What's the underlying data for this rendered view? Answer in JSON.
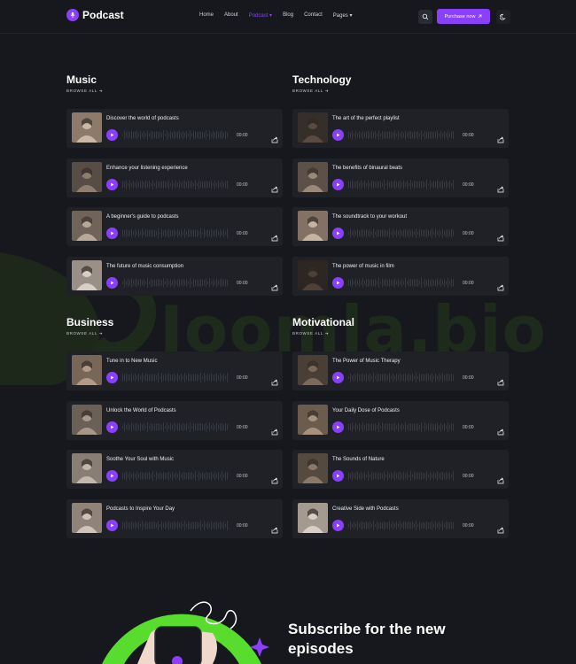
{
  "header": {
    "logo_text": "Podcast",
    "nav": [
      {
        "label": "Home",
        "active": false
      },
      {
        "label": "About",
        "active": false
      },
      {
        "label": "Podcast ▾",
        "active": true
      },
      {
        "label": "Blog",
        "active": false
      },
      {
        "label": "Contact",
        "active": false
      },
      {
        "label": "Pages ▾",
        "active": false
      }
    ],
    "purchase_label": "Purchase now",
    "accent": "#8a3ffc"
  },
  "watermark": "Joomla.bio",
  "sections": [
    {
      "title": "Music",
      "browse": "BROWSE ALL ➔",
      "items": [
        {
          "title": "Discover the world of podcasts",
          "time": "00:00"
        },
        {
          "title": "Enhance your listening experience",
          "time": "00:00"
        },
        {
          "title": "A beginner's guide to podcasts",
          "time": "00:00"
        },
        {
          "title": "The future of music consumption",
          "time": "00:00"
        }
      ]
    },
    {
      "title": "Technology",
      "browse": "BROWSE ALL ➔",
      "items": [
        {
          "title": "The art of the perfect playlist",
          "time": "00:00"
        },
        {
          "title": "The benefits of binaural beats",
          "time": "00:00"
        },
        {
          "title": "The soundtrack to your workout",
          "time": "00:00"
        },
        {
          "title": "The power of music in film",
          "time": "00:00"
        }
      ]
    },
    {
      "title": "Business",
      "browse": "BROWSE ALL ➔",
      "items": [
        {
          "title": "Tune in to New Music",
          "time": "00:00"
        },
        {
          "title": "Unlock the World of Podcasts",
          "time": "00:00"
        },
        {
          "title": "Soothe Your Soul with Music",
          "time": "00:00"
        },
        {
          "title": "Podcasts to Inspire Your Day",
          "time": "00:00"
        }
      ]
    },
    {
      "title": "Motivational",
      "browse": "BROWSE ALL ➔",
      "items": [
        {
          "title": "The Power of Music Therapy",
          "time": "00:00"
        },
        {
          "title": "Your Daily Dose of Podcasts",
          "time": "00:00"
        },
        {
          "title": "The Sounds of Nature",
          "time": "00:00"
        },
        {
          "title": "Creative Side with Podcasts",
          "time": "00:00"
        }
      ]
    }
  ],
  "subscribe": {
    "title": "Subscribe for the new episodes"
  }
}
